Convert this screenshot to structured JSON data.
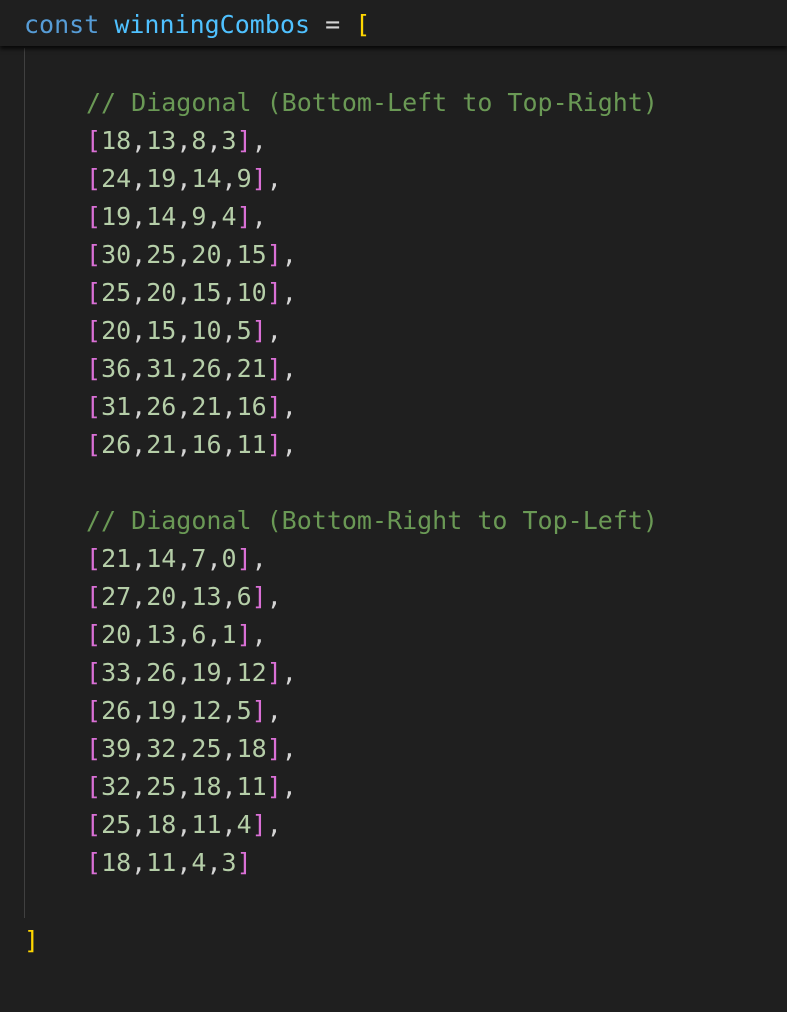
{
  "editor": {
    "header": {
      "keyword": "const",
      "variable": "winningCombos",
      "operator": "=",
      "open_bracket": "["
    },
    "closing_bracket": "]",
    "sections": [
      {
        "comment": "// Diagonal (Bottom-Left to Top-Right)",
        "rows": [
          "18,13,8,3",
          "24,19,14,9",
          "19,14,9,4",
          "30,25,20,15",
          "25,20,15,10",
          "20,15,10,5",
          "36,31,26,21",
          "31,26,21,16",
          "26,21,16,11"
        ]
      },
      {
        "comment": "// Diagonal (Bottom-Right to Top-Left)",
        "rows": [
          "21,14,7,0",
          "27,20,13,6",
          "20,13,6,1",
          "33,26,19,12",
          "26,19,12,5",
          "39,32,25,18",
          "32,25,18,11",
          "25,18,11,4",
          "18,11,4,3"
        ]
      }
    ],
    "colors": {
      "background": "#1f1f1f",
      "keyword": "#569cd6",
      "variable": "#4fc1ff",
      "outer_bracket": "#ffd700",
      "inner_bracket": "#da70d6",
      "number": "#b5cea8",
      "comment": "#6a9955"
    }
  }
}
